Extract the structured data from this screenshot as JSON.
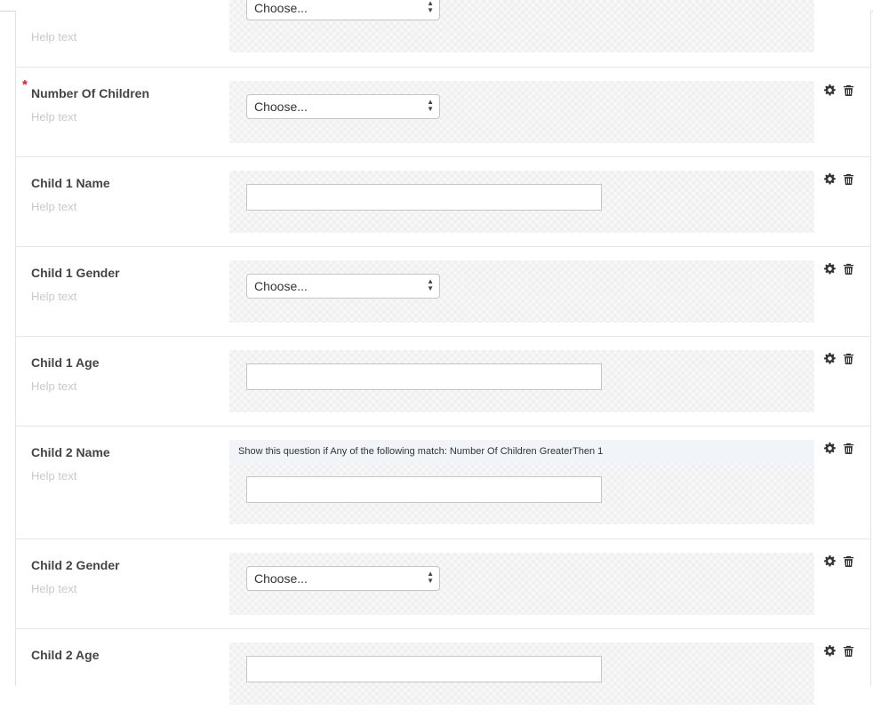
{
  "help_text": "Help text",
  "select_placeholder": "Choose...",
  "questions": [
    {
      "label": "",
      "required": false,
      "type": "select"
    },
    {
      "label": "Number Of Children",
      "required": true,
      "type": "select"
    },
    {
      "label": "Child 1 Name",
      "required": false,
      "type": "text"
    },
    {
      "label": "Child 1 Gender",
      "required": false,
      "type": "select"
    },
    {
      "label": "Child 1 Age",
      "required": false,
      "type": "text"
    },
    {
      "label": "Child 2 Name",
      "required": false,
      "type": "text",
      "condition": "Show this question if Any of the following match: Number Of Children GreaterThen 1"
    },
    {
      "label": "Child 2 Gender",
      "required": false,
      "type": "select"
    },
    {
      "label": "Child 2 Age",
      "required": false,
      "type": "text"
    }
  ],
  "required_marker": "*",
  "icons": {
    "settings": "gear-icon",
    "delete": "trash-icon"
  },
  "colors": {
    "required": "#e02020",
    "help": "#c9c9c9",
    "condition_bg": "#f1f5f9"
  }
}
